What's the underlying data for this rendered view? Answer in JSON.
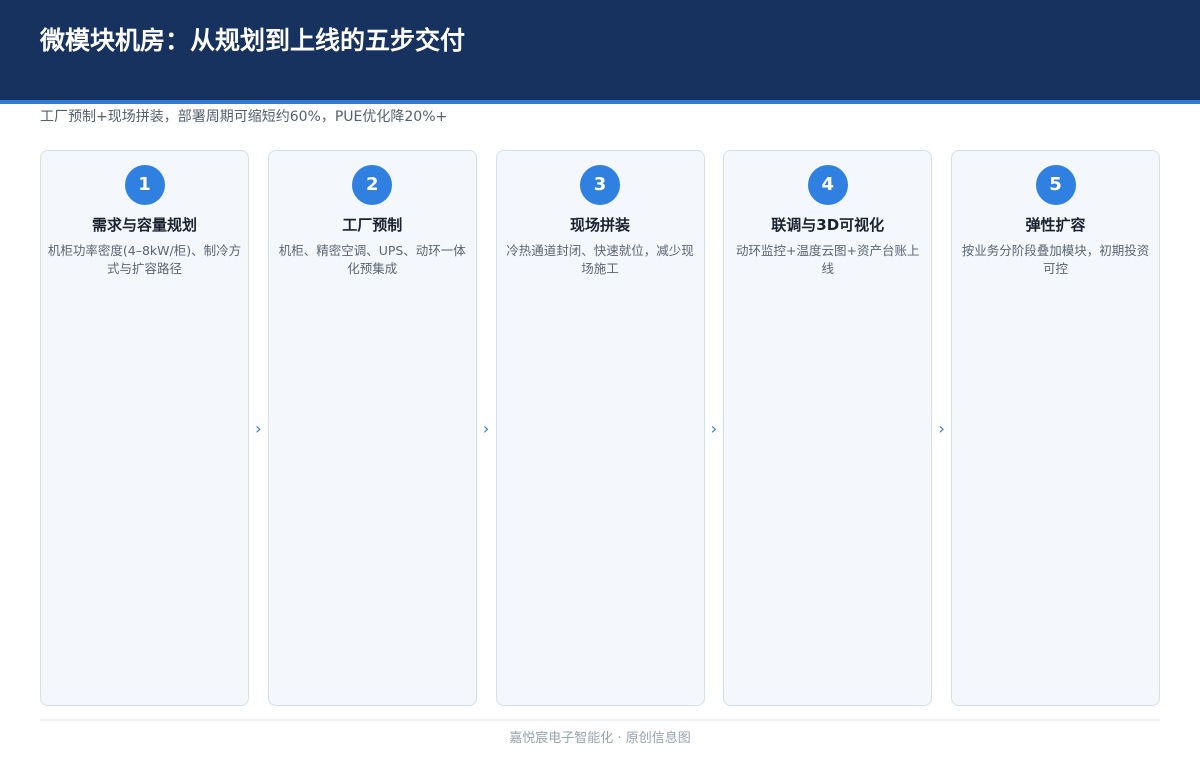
{
  "header": {
    "title": "微模块机房：从规划到上线的五步交付"
  },
  "subtitle": "工厂预制+现场拼装，部署周期可缩短约60%，PUE优化降20%+",
  "steps": [
    {
      "number": "1",
      "title": "需求与容量规划",
      "desc": "机柜功率密度(4–8kW/柜)、制冷方式与扩容路径"
    },
    {
      "number": "2",
      "title": "工厂预制",
      "desc": "机柜、精密空调、UPS、动环一体化预集成"
    },
    {
      "number": "3",
      "title": "现场拼装",
      "desc": "冷热通道封闭、快速就位，减少现场施工"
    },
    {
      "number": "4",
      "title": "联调与3D可视化",
      "desc": "动环监控+温度云图+资产台账上线"
    },
    {
      "number": "5",
      "title": "弹性扩容",
      "desc": "按业务分阶段叠加模块，初期投资可控"
    }
  ],
  "arrow_glyph": "›",
  "footer": "嘉悦宸电子智能化 · 原创信息图",
  "colors": {
    "header_bg": "#17325f",
    "accent": "#2f7bd8",
    "badge": "#2f80e0",
    "card_bg": "#f4f8fc"
  }
}
